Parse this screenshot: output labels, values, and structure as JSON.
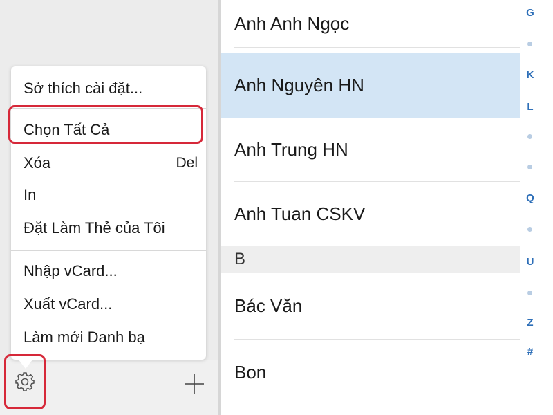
{
  "menu": {
    "items": [
      {
        "label": "Sở thích cài đặt...",
        "shortcut": ""
      },
      {
        "label": "Chọn Tất Cả",
        "shortcut": ""
      },
      {
        "label": "Xóa",
        "shortcut": "Del"
      },
      {
        "label": "In",
        "shortcut": ""
      },
      {
        "label": "Đặt Làm Thẻ của Tôi",
        "shortcut": ""
      },
      {
        "label": "Nhập vCard...",
        "shortcut": ""
      },
      {
        "label": "Xuất vCard...",
        "shortcut": ""
      },
      {
        "label": "Làm mới Danh bạ",
        "shortcut": ""
      }
    ],
    "highlighted_item": "Chọn Tất Cả"
  },
  "toolbar": {
    "settings_icon": "gear-icon",
    "add_icon": "plus-icon"
  },
  "contacts": {
    "rows": [
      {
        "name": "Anh Anh Ngọc",
        "selected": false
      },
      {
        "name": "Anh Nguyên HN",
        "selected": true
      },
      {
        "name": "Anh Trung HN",
        "selected": false
      },
      {
        "name": "Anh Tuan CSKV",
        "selected": false
      }
    ],
    "section_b": {
      "header": "B",
      "rows": [
        "Bác Văn",
        "Bon"
      ]
    }
  },
  "index": {
    "letters": [
      "G",
      "K",
      "L",
      "Q",
      "U",
      "Z",
      "#"
    ]
  },
  "colors": {
    "highlight_border": "#d62839",
    "selected_row": "#d3e5f5",
    "index_letter": "#2e6fb8"
  }
}
